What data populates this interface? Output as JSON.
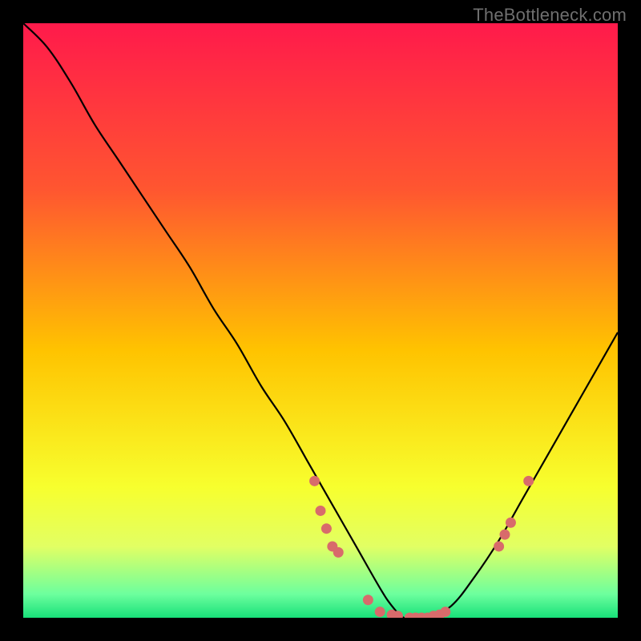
{
  "watermark": "TheBottleneck.com",
  "chart_data": {
    "type": "line",
    "title": "",
    "xlabel": "",
    "ylabel": "",
    "xlim": [
      0,
      100
    ],
    "ylim": [
      0,
      100
    ],
    "gradient_stops": [
      {
        "offset": 0,
        "color": "#ff1a4b"
      },
      {
        "offset": 28,
        "color": "#ff5630"
      },
      {
        "offset": 55,
        "color": "#ffc300"
      },
      {
        "offset": 78,
        "color": "#f7ff2e"
      },
      {
        "offset": 88,
        "color": "#e2ff63"
      },
      {
        "offset": 96,
        "color": "#6dff9e"
      },
      {
        "offset": 100,
        "color": "#18e079"
      }
    ],
    "series": [
      {
        "name": "bottleneck-curve",
        "x": [
          0,
          4,
          8,
          12,
          16,
          20,
          24,
          28,
          32,
          36,
          40,
          44,
          48,
          52,
          56,
          60,
          62,
          64,
          66,
          68,
          72,
          76,
          80,
          84,
          88,
          92,
          96,
          100
        ],
        "y": [
          100,
          96,
          90,
          83,
          77,
          71,
          65,
          59,
          52,
          46,
          39,
          33,
          26,
          19,
          12,
          5,
          2,
          0,
          0,
          0,
          2,
          7,
          13,
          20,
          27,
          34,
          41,
          48
        ]
      }
    ],
    "scatter_points": {
      "name": "data-points",
      "color": "#d86b6b",
      "points": [
        {
          "x": 49,
          "y": 23
        },
        {
          "x": 50,
          "y": 18
        },
        {
          "x": 51,
          "y": 15
        },
        {
          "x": 52,
          "y": 12
        },
        {
          "x": 53,
          "y": 11
        },
        {
          "x": 58,
          "y": 3
        },
        {
          "x": 60,
          "y": 1
        },
        {
          "x": 62,
          "y": 0.5
        },
        {
          "x": 63,
          "y": 0.3
        },
        {
          "x": 65,
          "y": 0
        },
        {
          "x": 66,
          "y": 0
        },
        {
          "x": 67,
          "y": 0
        },
        {
          "x": 68,
          "y": 0
        },
        {
          "x": 69,
          "y": 0.3
        },
        {
          "x": 70,
          "y": 0.5
        },
        {
          "x": 71,
          "y": 1
        },
        {
          "x": 80,
          "y": 12
        },
        {
          "x": 81,
          "y": 14
        },
        {
          "x": 82,
          "y": 16
        },
        {
          "x": 85,
          "y": 23
        }
      ]
    }
  }
}
